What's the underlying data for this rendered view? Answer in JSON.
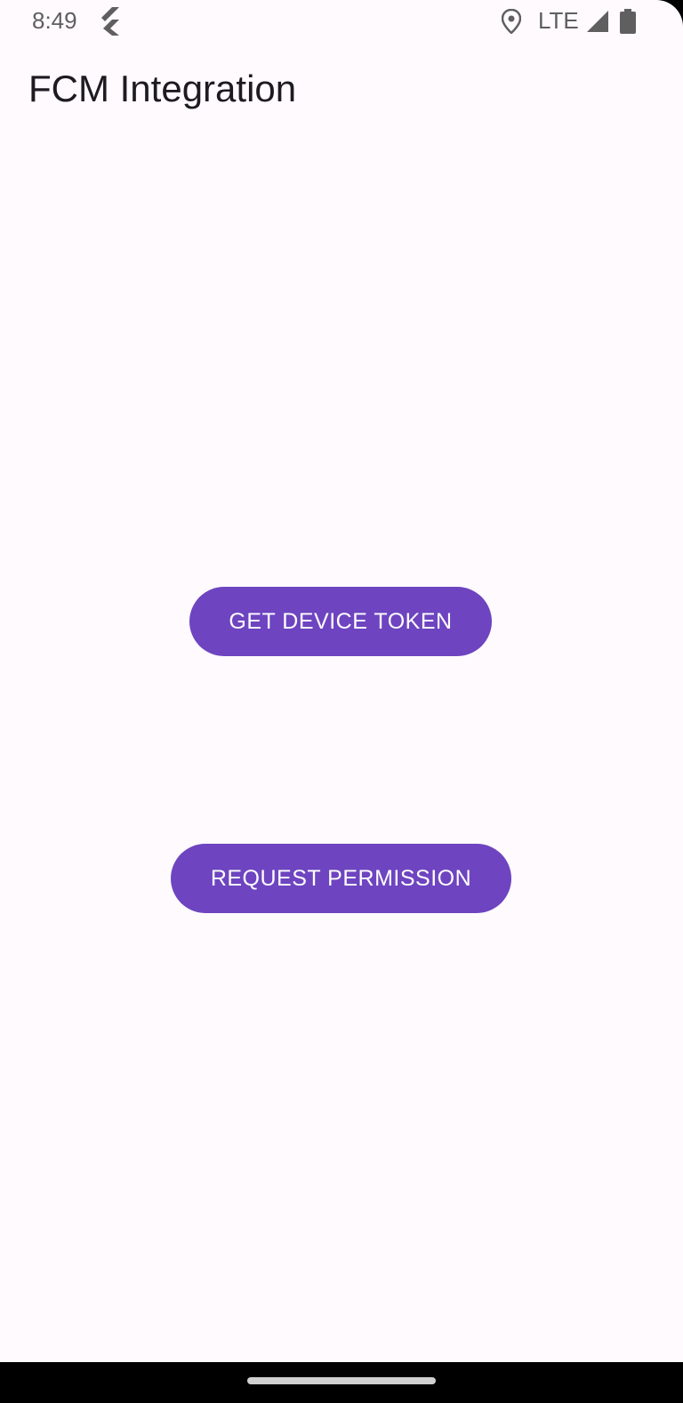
{
  "status_bar": {
    "time": "8:49",
    "network": "LTE",
    "icons": [
      "flutter-icon",
      "location-icon",
      "signal-icon",
      "battery-icon"
    ]
  },
  "app_bar": {
    "title": "FCM Integration"
  },
  "buttons": {
    "get_device_token": "GET DEVICE TOKEN",
    "request_permission": "REQUEST PERMISSION"
  },
  "colors": {
    "background": "#fefafe",
    "button": "#6e44c0",
    "button_text": "#ffffff",
    "title_text": "#1d1b20",
    "status_text": "#5f5f5f"
  }
}
